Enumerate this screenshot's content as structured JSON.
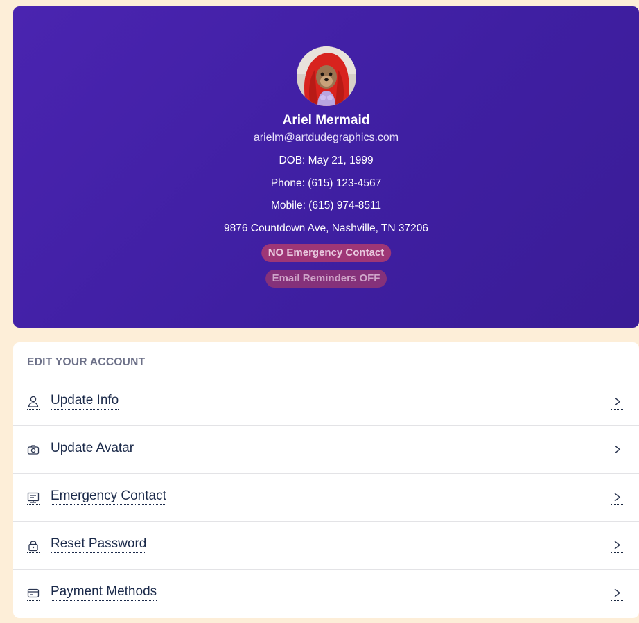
{
  "profile": {
    "name": "Ariel Mermaid",
    "email": "arielm@artdudegraphics.com",
    "dob": "DOB: May 21, 1999",
    "phone": "Phone: (615) 123-4567",
    "mobile": "Mobile: (615) 974-8511",
    "address": "9876 Countdown Ave, Nashville, TN 37206",
    "badges": {
      "emergency": "NO Emergency Contact",
      "reminders": "Email Reminders OFF"
    }
  },
  "account": {
    "title": "EDIT YOUR ACCOUNT",
    "items": [
      {
        "label": "Update Info",
        "icon": "user-icon"
      },
      {
        "label": "Update Avatar",
        "icon": "camera-icon"
      },
      {
        "label": "Emergency Contact",
        "icon": "contact-icon"
      },
      {
        "label": "Reset Password",
        "icon": "lock-icon"
      },
      {
        "label": "Payment Methods",
        "icon": "credit-card-icon"
      }
    ]
  },
  "colors": {
    "page_bg": "#fdeed8",
    "profile_bg": "#4326a8",
    "badge_bg": "#9e3676",
    "text_dark": "#1b2a4a"
  }
}
